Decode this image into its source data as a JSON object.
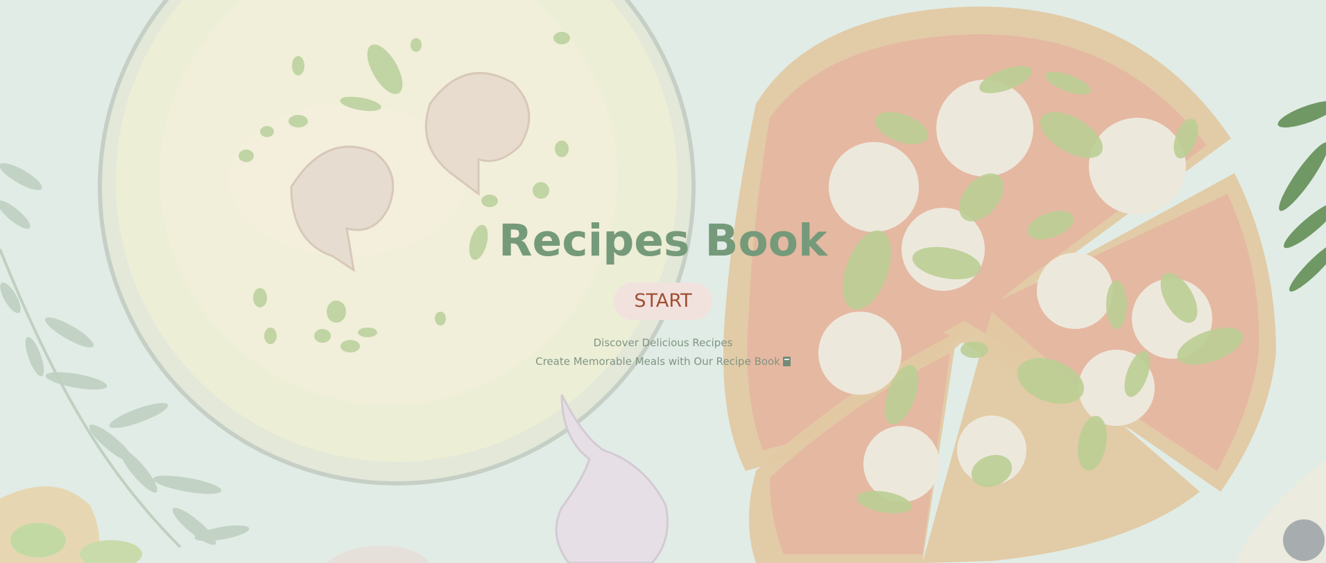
{
  "page": {
    "background": "#e1ece6",
    "title": "Recipes Book",
    "start_label": "START",
    "tagline_1": "Discover Delicious Recipes",
    "tagline_2": "Create Memorable Meals with Our Recipe Book",
    "tagline_icon": "book-icon"
  },
  "colors": {
    "title": "#759a7a",
    "button_bg": "#f1e2de",
    "button_text": "#a24e32",
    "tagline": "#7f9583"
  },
  "background_illustration": {
    "items": [
      "soup-bowl-illustration",
      "pizza-illustration",
      "garlic-illustration",
      "herb-sprig-illustration",
      "rosemary-illustration",
      "vegetables-illustration",
      "olive-bowl-illustration"
    ]
  }
}
